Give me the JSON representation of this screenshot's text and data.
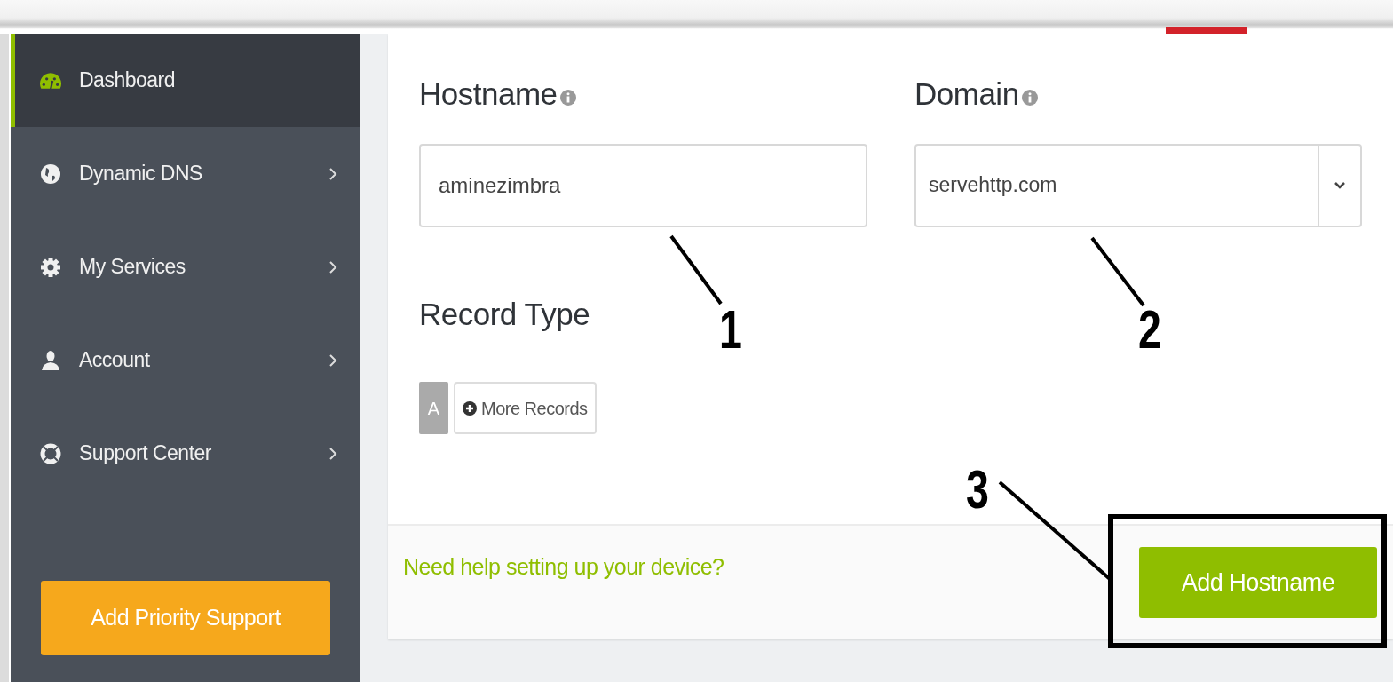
{
  "sidebar": {
    "items": [
      {
        "label": "Dashboard",
        "selected": true,
        "has_submenu": false
      },
      {
        "label": "Dynamic DNS",
        "selected": false,
        "has_submenu": true
      },
      {
        "label": "My Services",
        "selected": false,
        "has_submenu": true
      },
      {
        "label": "Account",
        "selected": false,
        "has_submenu": true
      },
      {
        "label": "Support Center",
        "selected": false,
        "has_submenu": true
      }
    ],
    "cta": "Add Priority Support"
  },
  "form": {
    "hostname": {
      "label": "Hostname",
      "value": "aminezimbra"
    },
    "domain": {
      "label": "Domain",
      "value": "servehttp.com"
    },
    "record_type": {
      "label": "Record Type",
      "current": "A",
      "more_button": "More Records"
    }
  },
  "footer": {
    "help_link": "Need help setting up your device?",
    "submit": "Add Hostname"
  },
  "annotations": [
    {
      "label": "1"
    },
    {
      "label": "2"
    },
    {
      "label": "3"
    }
  ]
}
